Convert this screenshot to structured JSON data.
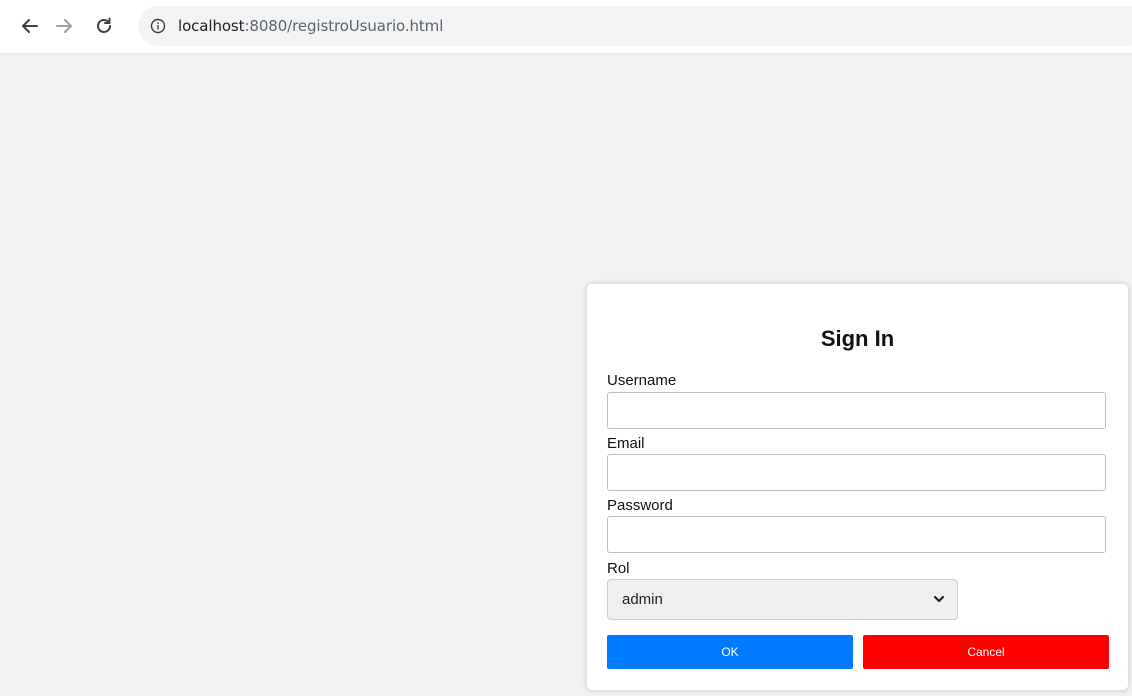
{
  "browser": {
    "url_host": "localhost",
    "url_rest": ":8080/registroUsuario.html",
    "icons": {
      "back": "arrow-left-icon",
      "forward": "arrow-right-icon",
      "reload": "reload-icon",
      "info": "info-icon"
    }
  },
  "form": {
    "title": "Sign In",
    "username_label": "Username",
    "username_value": "",
    "email_label": "Email",
    "email_value": "",
    "password_label": "Password",
    "password_value": "",
    "rol_label": "Rol",
    "rol_selected": "admin",
    "ok_label": "OK",
    "cancel_label": "Cancel"
  },
  "colors": {
    "ok_button": "#007bff",
    "cancel_button": "#ff0000",
    "page_background": "#f1f1f1"
  }
}
